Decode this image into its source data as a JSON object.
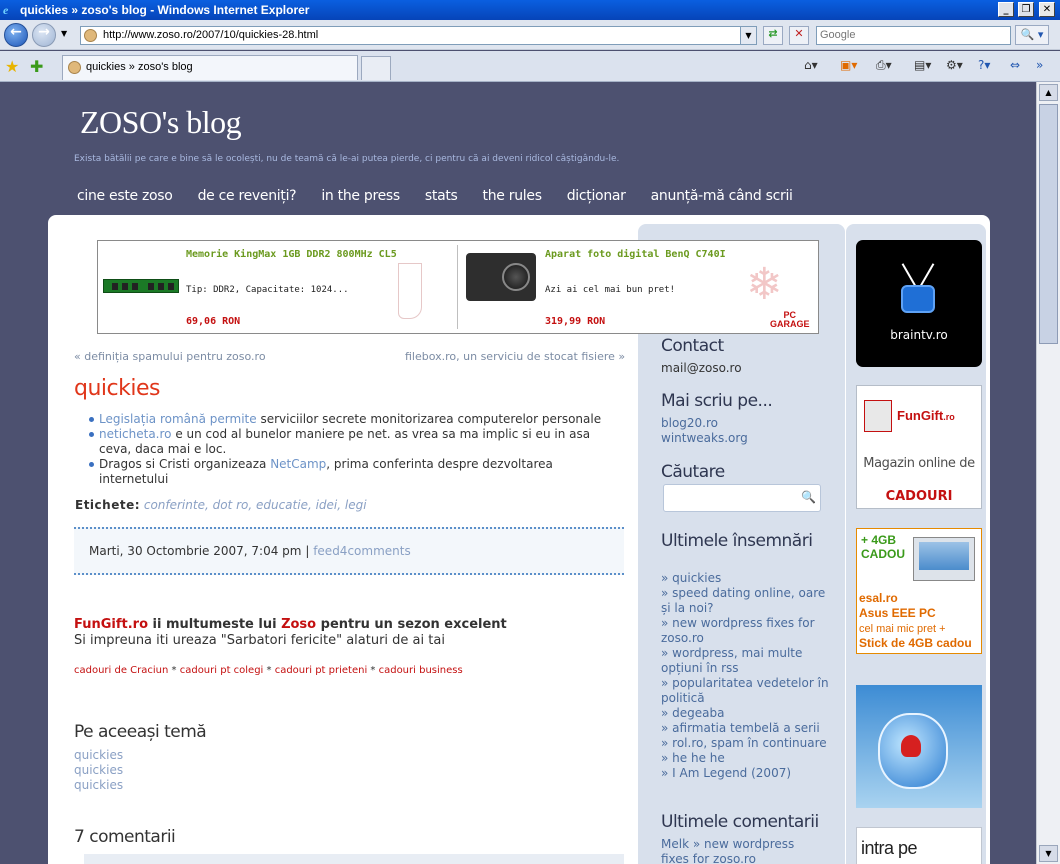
{
  "window": {
    "title": "quickies » zoso's blog - Windows Internet Explorer",
    "minimize": "_",
    "maximize": "❐",
    "close": "✕"
  },
  "navbar": {
    "back": "←",
    "forward": "→",
    "url": "http://www.zoso.ro/2007/10/quickies-28.html",
    "search_placeholder": "Google"
  },
  "tabs": [
    {
      "label": "quickies » zoso's blog"
    }
  ],
  "blog": {
    "title": "ZOSO's blog",
    "tagline": "Exista bătălii pe care e bine să le ocolești, nu de teamă că le-ai putea pierde, ci pentru că ai deveni ridicol câștigându-le.",
    "menu": [
      "cine este zoso",
      "de ce reveniți?",
      "in the press",
      "stats",
      "the rules",
      "dicționar",
      "anunță-mă când scrii"
    ]
  },
  "ad": {
    "left": {
      "name": "Memorie KingMax 1GB DDR2 800MHz CL5",
      "desc": "Tip: DDR2, Capacitate: 1024...",
      "price": "69,06 RON"
    },
    "right": {
      "name": "Aparat foto digital BenQ C740I",
      "desc": "Azi ai cel mai bun pret!",
      "price": "319,99 RON"
    },
    "brand_line1": "PC",
    "brand_line2": "GARAGE"
  },
  "post_nav": {
    "prev": "« definiția spamului pentru zoso.ro",
    "next": "filebox.ro, un serviciu de stocat fisiere »"
  },
  "post": {
    "title": "quickies",
    "items": [
      {
        "link": "Legislația română permite",
        "text": " serviciilor secrete monitorizarea computerelor personale"
      },
      {
        "link": "neticheta.ro",
        "text": " e un cod al bunelor maniere pe net. as vrea sa ma implic si eu in asa ceva, daca mai e loc."
      },
      {
        "pre": "Dragos si Cristi organizeaza ",
        "link": "NetCamp",
        "text": ", prima conferinta despre dezvoltarea internetului"
      }
    ],
    "tags_label": "Etichete:",
    "tags": "conferinte, dot ro, educatie, idei, legi",
    "date": "Marti, 30 Octombrie 2007, 7:04 pm",
    "separator": "|",
    "feed": "feed4comments"
  },
  "promo": {
    "brand": "FunGift.ro",
    "thanks_pre": " ii multumeste lui ",
    "thanks_name": "Zoso",
    "thanks_post": " pentru un sezon excelent",
    "line2": "Si impreuna iti ureaza \"Sarbatori fericite\" alaturi de ai tai",
    "links": [
      "cadouri de Craciun",
      "cadouri pt colegi",
      "cadouri pt prieteni",
      "cadouri business"
    ],
    "sep": " * "
  },
  "related": {
    "heading": "Pe aceeași temă",
    "items": [
      "quickies",
      "quickies",
      "quickies"
    ]
  },
  "comments": {
    "heading": "7 comentarii"
  },
  "sidebar": {
    "contact_h": "Contact",
    "contact": "mail@zoso.ro",
    "more_h": "Mai scriu pe...",
    "more": [
      "blog20.ro",
      "wintweaks.org"
    ],
    "search_h": "Căutare",
    "recent_h": "Ultimele însemnări",
    "recent": [
      "» quickies",
      "» speed dating online, oare și la noi?",
      "» new wordpress fixes for zoso.ro",
      "» wordpress, mai multe opțiuni în rss",
      "» popularitatea vedetelor în politică",
      "» degeaba",
      "» afirmatia tembelă a serii",
      "» rol.ro, spam în continuare",
      "» he he he",
      "» I Am Legend (2007)"
    ],
    "comments_h": "Ultimele comentarii",
    "comments": [
      "Melk » new wordpress fixes for zoso.ro"
    ]
  },
  "banners": {
    "braintv": "braintv.ro",
    "fungift_logo": "FunGift",
    "fungift_tld": ".ro",
    "fungift_line1": "Magazin online de",
    "fungift_line2": "CADOURI",
    "esal": [
      "+ 4GB",
      "CADOU"
    ],
    "esal_text": [
      "esal.ro",
      "Asus EEE PC",
      "cel mai mic pret +",
      "Stick de 4GB cadou"
    ],
    "intra": "intra pe"
  }
}
